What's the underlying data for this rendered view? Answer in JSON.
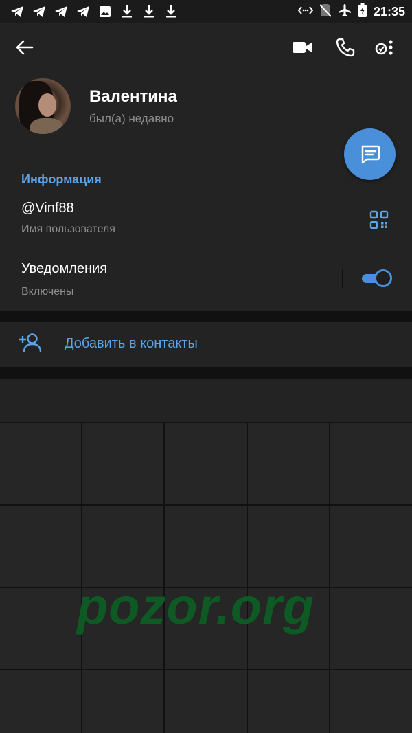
{
  "status_bar": {
    "time": "21:35",
    "icons_left": [
      "telegram-icon",
      "telegram-icon",
      "telegram-icon",
      "telegram-icon",
      "image-icon",
      "download-icon",
      "download-icon",
      "download-icon"
    ],
    "icons_right": [
      "nfc-icon",
      "no-sim-icon",
      "airplane-icon",
      "battery-charging-icon"
    ]
  },
  "toolbar": {
    "back": "back-arrow-icon",
    "video": "video-call-icon",
    "call": "phone-icon",
    "more": "more-icon"
  },
  "profile": {
    "name": "Валентина",
    "status": "был(а) недавно"
  },
  "info": {
    "title": "Информация",
    "username_value": "@Vinf88",
    "username_label": "Имя пользователя",
    "notifications_value": "Уведомления",
    "notifications_label": "Включены",
    "notifications_on": true
  },
  "actions": {
    "add_contact": "Добавить в контакты"
  },
  "watermark": "pozor.org",
  "colors": {
    "accent": "#4a8fd9",
    "link": "#5da4e6",
    "background": "#232323",
    "watermark": "#0f5a24"
  }
}
